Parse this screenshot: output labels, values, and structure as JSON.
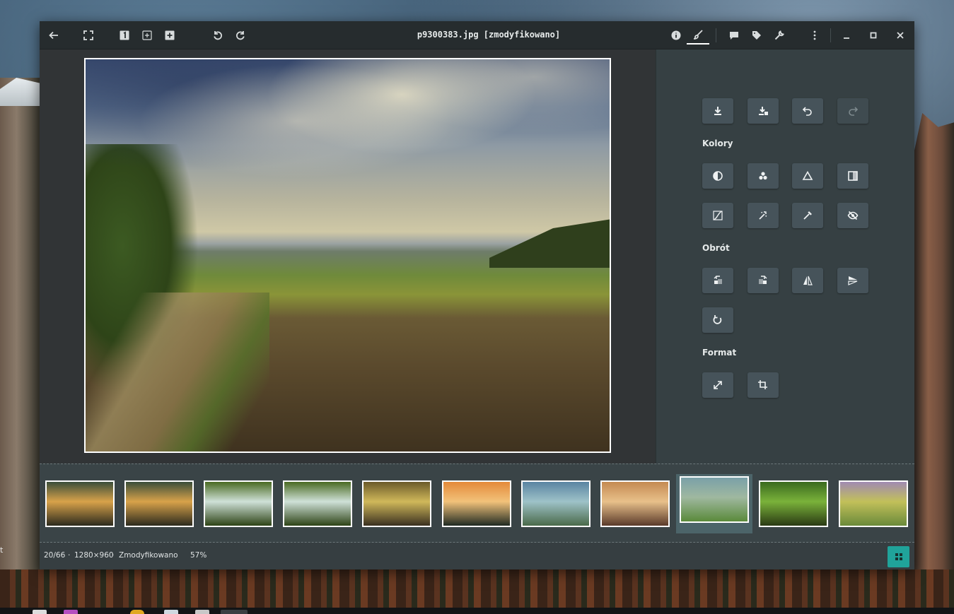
{
  "window": {
    "title": "p9300383.jpg [zmodyfikowano]"
  },
  "desktop": {
    "edge_char": "t"
  },
  "toolbar": {
    "left_icons": [
      "back-arrow-icon",
      "fullscreen-icon",
      "actual-size-icon",
      "fit-icon",
      "zoom-in-icon",
      "rotate-left-icon",
      "rotate-right-icon"
    ],
    "right_icons": [
      "info-icon",
      "edit-brush-icon",
      "comment-icon",
      "tag-icon",
      "wrench-icon",
      "more-vertical-icon",
      "minimize-icon",
      "maximize-icon",
      "close-icon"
    ]
  },
  "sidebar": {
    "sections": {
      "colors": "Kolory",
      "rotation": "Obrót",
      "format": "Format"
    },
    "top_tools": [
      "save-icon",
      "save-as-icon",
      "undo-icon",
      "redo-icon"
    ],
    "color_tools": [
      "contrast-icon",
      "rgb-icon",
      "exposure-icon",
      "gradient-icon",
      "curves-icon",
      "magic-wand-icon",
      "eyedropper-icon",
      "hide-icon"
    ],
    "rotation_tools": [
      "rotate-ccw-icon",
      "rotate-cw-icon",
      "flip-horizontal-icon",
      "flip-vertical-icon",
      "rotate-free-icon"
    ],
    "format_tools": [
      "resize-icon",
      "crop-icon"
    ],
    "redo_disabled": true
  },
  "filmstrip": {
    "count": 11,
    "selected_index": 8,
    "thumbnails": [
      {
        "name": "forest-sunset-1",
        "colors": [
          "#3a4e3a",
          "#d8a24a",
          "#2c2a1e"
        ]
      },
      {
        "name": "forest-sunset-2",
        "colors": [
          "#3a4e3a",
          "#d8a24a",
          "#2c2a1e"
        ]
      },
      {
        "name": "waterfall-1",
        "colors": [
          "#4a6a22",
          "#cfe1d8",
          "#2e4416"
        ]
      },
      {
        "name": "waterfall-2",
        "colors": [
          "#4a6a22",
          "#cfe1d8",
          "#2e4416"
        ]
      },
      {
        "name": "rain-drops",
        "colors": [
          "#6b5a2a",
          "#d0b85a",
          "#3a3020"
        ]
      },
      {
        "name": "mountain-sunset",
        "colors": [
          "#e48a3a",
          "#f2c27a",
          "#1f2a22"
        ]
      },
      {
        "name": "misty-trees",
        "colors": [
          "#5a84a2",
          "#9ec2c8",
          "#4a6a4a"
        ]
      },
      {
        "name": "foggy-sunrise",
        "colors": [
          "#c48a52",
          "#e8c08a",
          "#5a3a2a"
        ]
      },
      {
        "name": "green-field",
        "colors": [
          "#7aa0a8",
          "#9fb8a0",
          "#5a8a3a"
        ]
      },
      {
        "name": "river-reflection",
        "colors": [
          "#3a6a1e",
          "#7ab23a",
          "#2a3a14"
        ]
      },
      {
        "name": "meadow-bokeh",
        "colors": [
          "#a08ab2",
          "#c2c05a",
          "#6a8a3a"
        ]
      }
    ]
  },
  "status": {
    "position": "20/66",
    "separator": "·",
    "resolution": "1280×960",
    "modified": "Zmodyfikowano",
    "zoom": "57%"
  },
  "colors": {
    "accent": "#20a39a",
    "window_bg": "#2f3537",
    "sidebar_bg": "#364043",
    "tool_bg": "#46535a"
  }
}
